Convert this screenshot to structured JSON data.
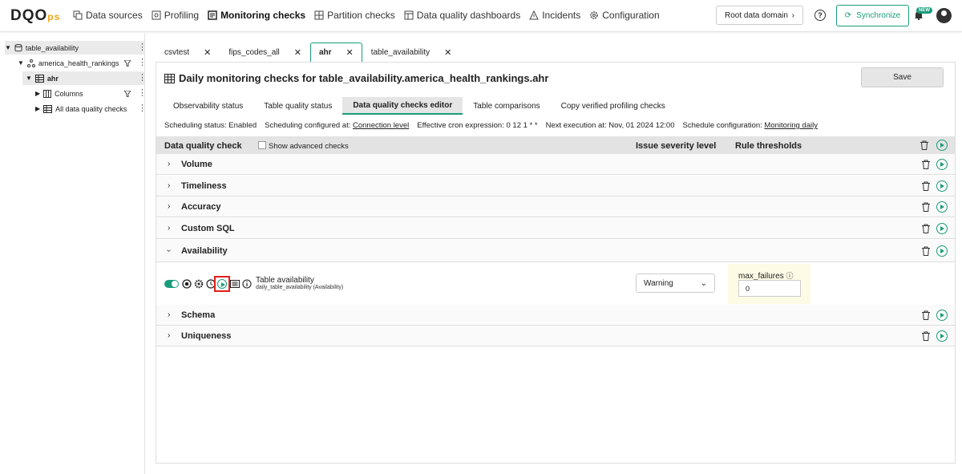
{
  "logo": {
    "main": "DQO",
    "suffix": "ps"
  },
  "nav": [
    {
      "label": "Data sources",
      "icon": "data-sources-icon"
    },
    {
      "label": "Profiling",
      "icon": "profiling-icon"
    },
    {
      "label": "Monitoring checks",
      "icon": "monitoring-icon",
      "active": true
    },
    {
      "label": "Partition checks",
      "icon": "partition-icon"
    },
    {
      "label": "Data quality dashboards",
      "icon": "dashboard-icon"
    },
    {
      "label": "Incidents",
      "icon": "warning-icon"
    },
    {
      "label": "Configuration",
      "icon": "gear-icon"
    }
  ],
  "header": {
    "domain": "Root data domain",
    "sync": "Synchronize",
    "new_badge": "NEW"
  },
  "tree": [
    {
      "label": "table_availability"
    },
    {
      "label": "america_health_rankings"
    },
    {
      "label": "ahr"
    },
    {
      "label": "Columns"
    },
    {
      "label": "All data quality checks"
    }
  ],
  "tabs": [
    "csvtest",
    "fips_codes_all",
    "ahr",
    "table_availability"
  ],
  "panel": {
    "title": "Daily monitoring checks for table_availability.america_health_rankings.ahr",
    "save": "Save",
    "subtabs": [
      "Observability status",
      "Table quality status",
      "Data quality checks editor",
      "Table comparisons",
      "Copy verified profiling checks"
    ],
    "schedule": {
      "status": "Scheduling status: Enabled",
      "configured_label": "Scheduling configured at:",
      "configured_value": "Connection level",
      "cron": "Effective cron expression: 0 12 1 * *",
      "next": "Next execution at: Nov, 01 2024 12:00",
      "config_label": "Schedule configuration:",
      "config_value": "Monitoring daily"
    },
    "columns": {
      "check": "Data quality check",
      "advanced": "Show advanced checks",
      "severity": "Issue severity level",
      "thresholds": "Rule thresholds"
    },
    "categories": [
      "Volume",
      "Timeliness",
      "Accuracy",
      "Custom SQL",
      "Availability",
      "Schema",
      "Uniqueness"
    ],
    "check": {
      "name": "Table availability",
      "sub": "daily_table_availability (Availability)",
      "severity": "Warning",
      "threshold_label": "max_failures",
      "threshold_value": "0"
    }
  }
}
